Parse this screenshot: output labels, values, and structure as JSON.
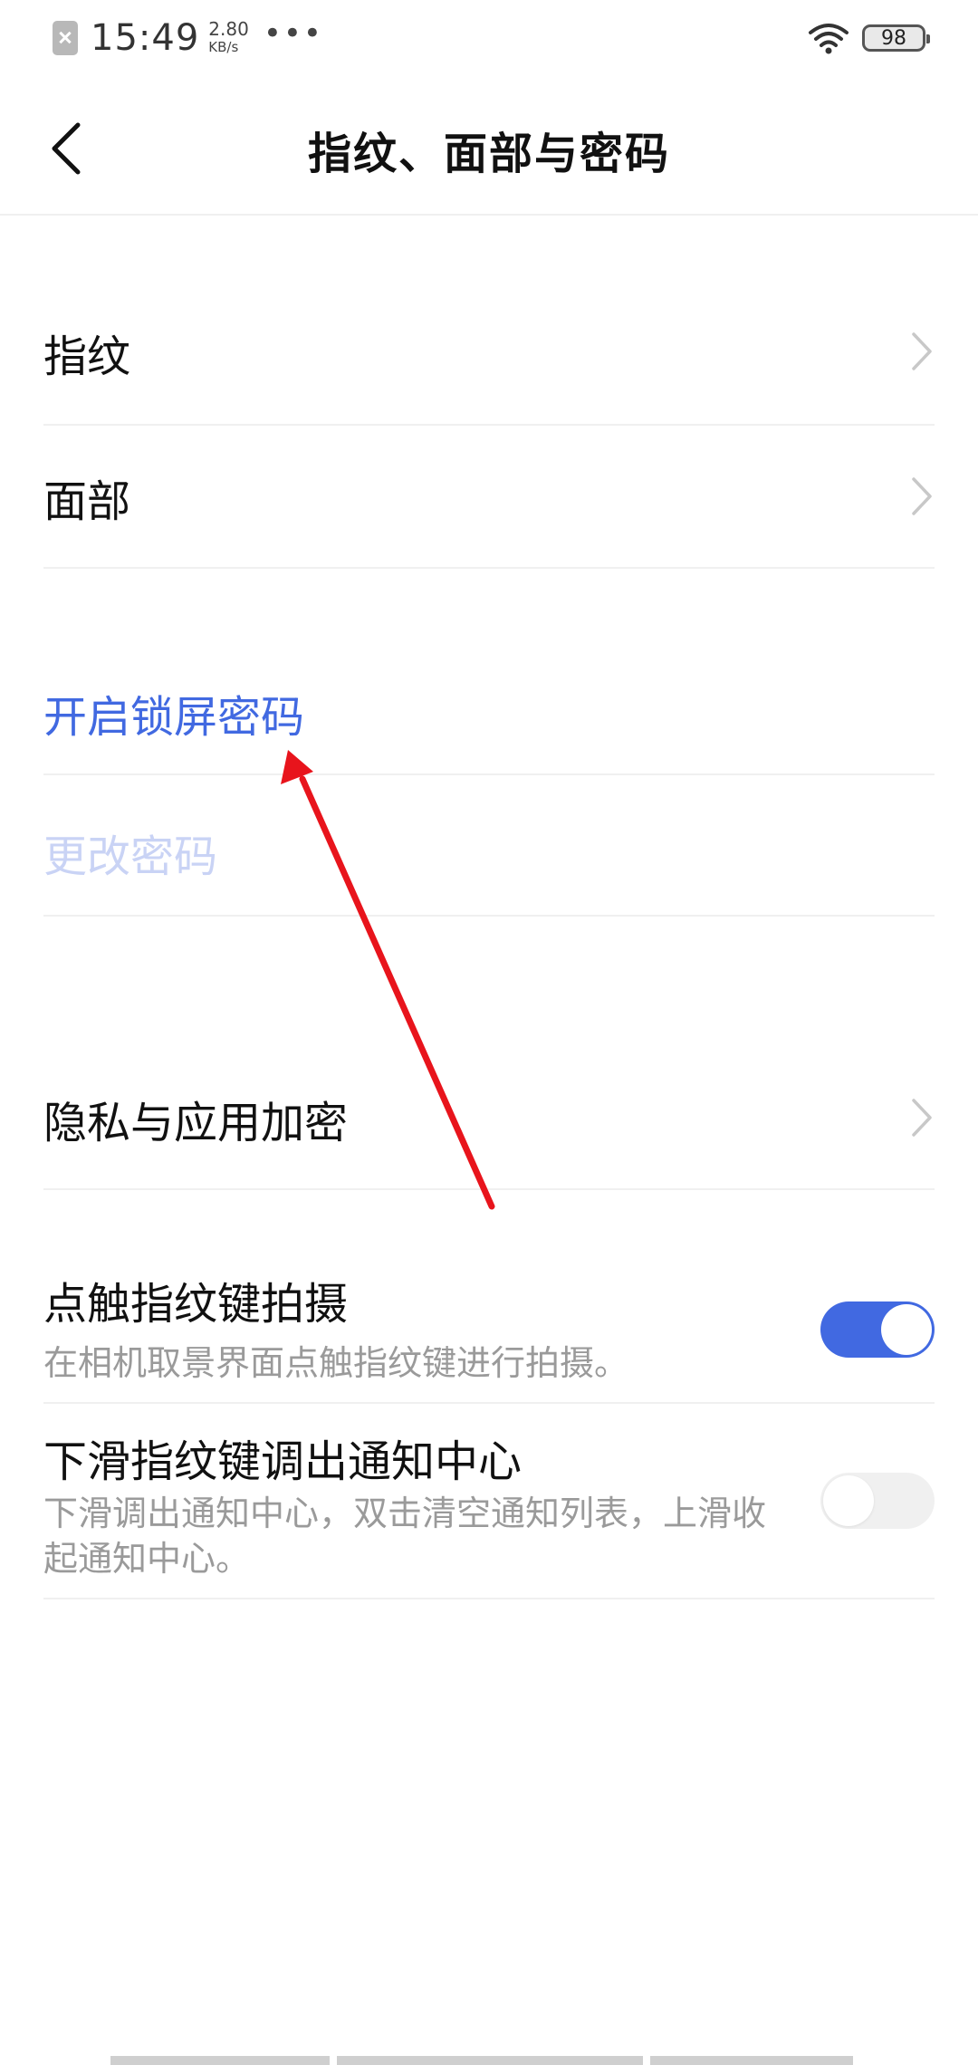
{
  "status_bar": {
    "time": "15:49",
    "net_speed_value": "2.80",
    "net_speed_unit": "KB/s",
    "more_dots": "•••",
    "battery": "98",
    "notification_icon": "app-blocked-icon",
    "wifi_icon": "wifi-icon"
  },
  "header": {
    "title": "指纹、面部与密码",
    "back_icon": "back-arrow-icon"
  },
  "items": {
    "fingerprint": "指纹",
    "face": "面部",
    "enable_lock_password": "开启锁屏密码",
    "change_password": "更改密码",
    "privacy_app_encryption": "隐私与应用加密"
  },
  "toggles": {
    "tap_capture": {
      "label": "点触指纹键拍摄",
      "description": "在相机取景界面点触指纹键进行拍摄。",
      "enabled": true
    },
    "swipe_notification": {
      "label": "下滑指纹键调出通知中心",
      "description": "下滑调出通知中心，双击清空通知列表，上滑收起通知中心。",
      "enabled": false
    }
  },
  "colors": {
    "accent": "#4169e1",
    "disabled_accent": "#c9d3f5",
    "annotation_arrow": "#e8141c",
    "divider": "#f0f0f0",
    "secondary_text": "#9a9a9a"
  }
}
